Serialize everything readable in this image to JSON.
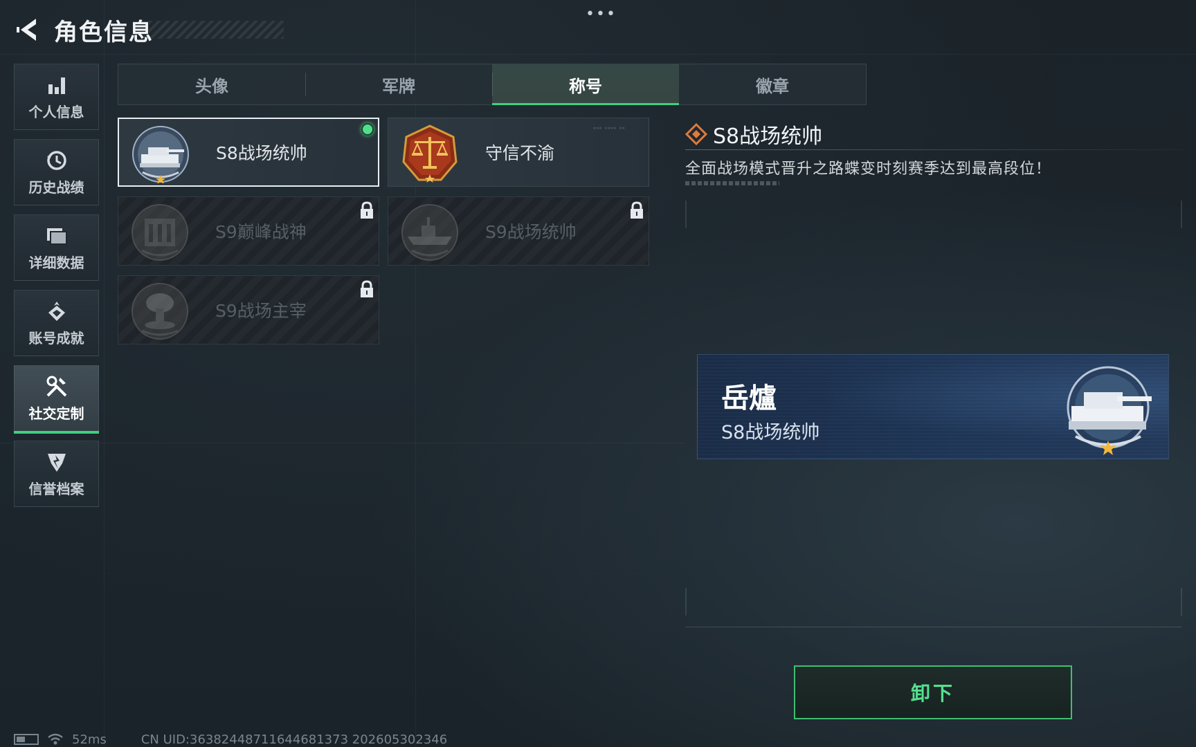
{
  "header": {
    "title": "角色信息",
    "more": "•••"
  },
  "sidebar": {
    "items": [
      {
        "label": "个人信息",
        "icon": "bar-chart-icon",
        "active": false
      },
      {
        "label": "历史战绩",
        "icon": "clock-history-icon",
        "active": false
      },
      {
        "label": "详细数据",
        "icon": "folder-icon",
        "active": false
      },
      {
        "label": "账号成就",
        "icon": "achievement-icon",
        "active": false
      },
      {
        "label": "社交定制",
        "icon": "tools-icon",
        "active": true
      },
      {
        "label": "信誉档案",
        "icon": "shield-icon",
        "active": false
      }
    ]
  },
  "tabs": [
    {
      "label": "头像",
      "active": false
    },
    {
      "label": "军牌",
      "active": false
    },
    {
      "label": "称号",
      "active": true
    },
    {
      "label": "徽章",
      "active": false
    }
  ],
  "titles": [
    {
      "name": "S8战场统帅",
      "emblem": "tank-emblem-icon",
      "locked": false,
      "equipped": true,
      "selected": true
    },
    {
      "name": "守信不渝",
      "emblem": "scales-emblem-icon",
      "locked": false,
      "equipped": false,
      "selected": false
    },
    {
      "name": "S9巅峰战神",
      "emblem": "fortress-emblem-icon",
      "locked": true,
      "equipped": false,
      "selected": false
    },
    {
      "name": "S9战场统帅",
      "emblem": "warship-emblem-icon",
      "locked": true,
      "equipped": false,
      "selected": false
    },
    {
      "name": "S9战场主宰",
      "emblem": "mushroom-cloud-emblem-icon",
      "locked": true,
      "equipped": false,
      "selected": false
    }
  ],
  "detail": {
    "title": "S8战场统帅",
    "description": "全面战场模式晋升之路蝶变时刻赛季达到最高段位！",
    "nameplate": {
      "player_name": "岳爐",
      "title": "S8战场统帅"
    },
    "action_label": "卸下"
  },
  "status_bar": {
    "ping": "52ms",
    "uid": "CN UID:36382448711644681373 202605302346"
  },
  "colors": {
    "accent_green": "#3fd07f",
    "background": "#1c252c",
    "nameplate_blue": "#1e3556",
    "emblem_gold": "#c98a2a"
  }
}
